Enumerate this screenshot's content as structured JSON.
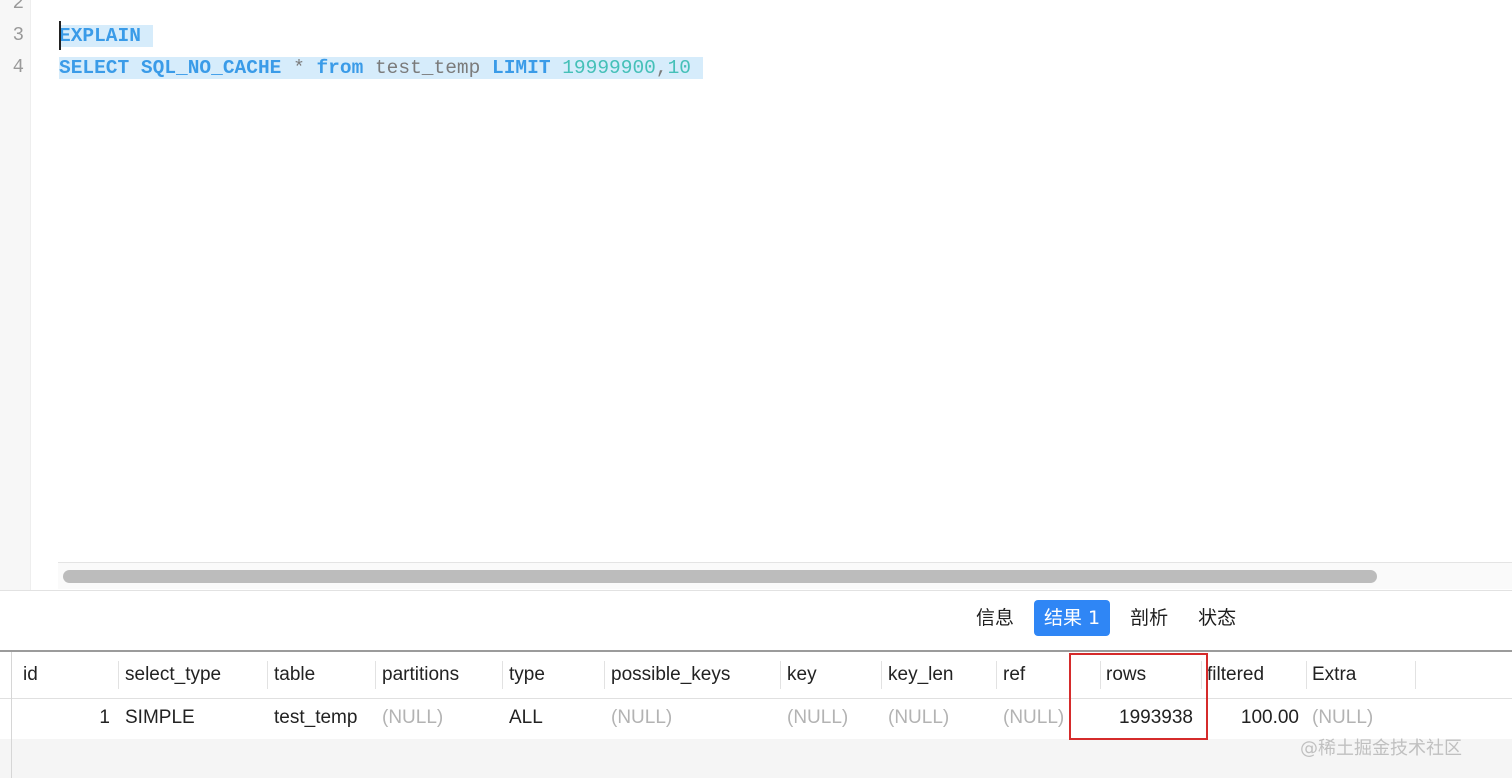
{
  "editor": {
    "line_numbers": [
      "2",
      "3",
      "4"
    ],
    "line3": {
      "kw": "EXPLAIN"
    },
    "line4": {
      "select": "SELECT",
      "sql_no_cache": "SQL_NO_CACHE",
      "star": "*",
      "from": "from",
      "table": "test_temp",
      "limit": "LIMIT",
      "offset": "19999900",
      "comma": ",",
      "count": "10"
    }
  },
  "tabs": {
    "info": "信息",
    "result1": "结果 1",
    "profile": "剖析",
    "status": "状态"
  },
  "grid": {
    "columns": [
      "id",
      "select_type",
      "table",
      "partitions",
      "type",
      "possible_keys",
      "key",
      "key_len",
      "ref",
      "rows",
      "filtered",
      "Extra"
    ],
    "row": {
      "id": "1",
      "select_type": "SIMPLE",
      "table": "test_temp",
      "partitions": "(NULL)",
      "type": "ALL",
      "possible_keys": "(NULL)",
      "key": "(NULL)",
      "key_len": "(NULL)",
      "ref": "(NULL)",
      "rows": "1993938",
      "filtered": "100.00",
      "Extra": "(NULL)"
    }
  },
  "watermark": "@稀土掘金技术社区",
  "colors": {
    "keyword": "#3a9be8",
    "number": "#45c0b8",
    "selection": "#d6ecfb",
    "active_tab": "#2f86f5",
    "highlight_box": "#d52b2b"
  }
}
